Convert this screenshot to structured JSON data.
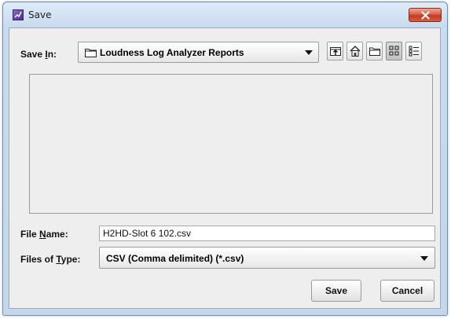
{
  "window": {
    "title": "Save"
  },
  "look_in": {
    "label_pre": "Save ",
    "label_key": "I",
    "label_post": "n:",
    "value": "Loudness Log Analyzer Reports"
  },
  "toolbar": {
    "icons": [
      "up-one-level-icon",
      "home-icon",
      "new-folder-icon",
      "list-view-icon",
      "details-view-icon"
    ]
  },
  "file_name": {
    "label_pre": "File ",
    "label_key": "N",
    "label_post": "ame:",
    "value": "H2HD-Slot 6 102.csv"
  },
  "file_type": {
    "label_pre": "Files of ",
    "label_key": "T",
    "label_post": "ype:",
    "value": "CSV (Comma delimited) (*.csv)"
  },
  "buttons": {
    "save": "Save",
    "cancel": "Cancel"
  },
  "colors": {
    "title_accent": "#5b3a9e",
    "close": "#d04a30"
  }
}
